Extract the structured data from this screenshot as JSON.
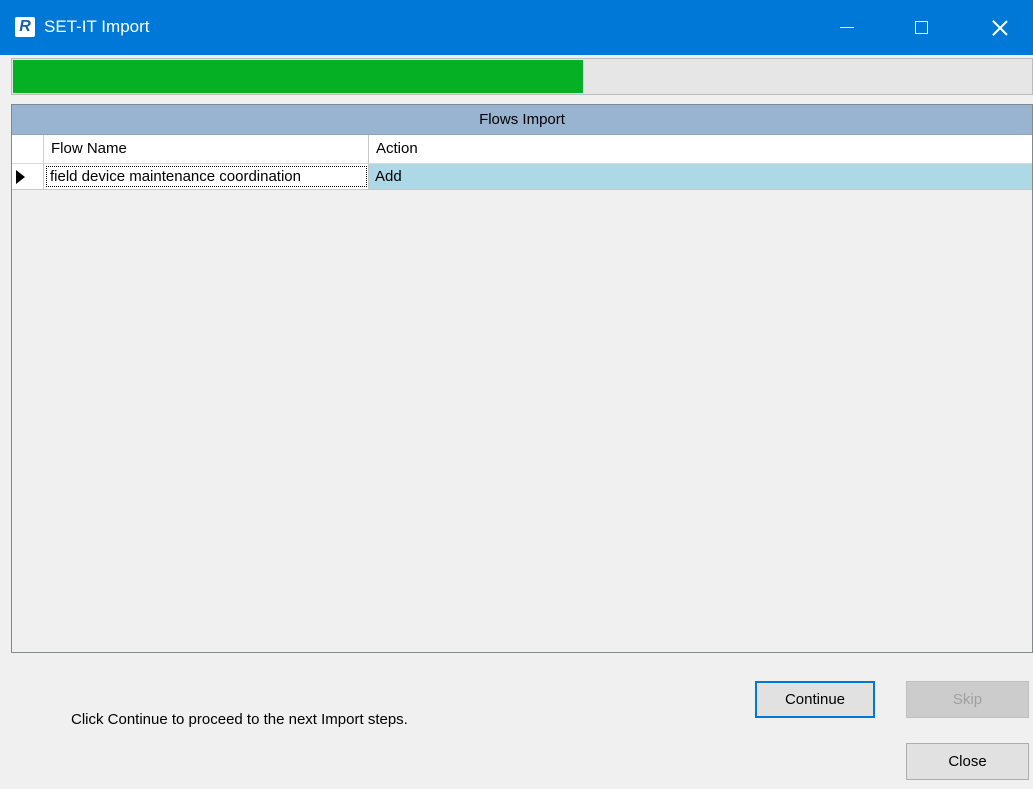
{
  "window": {
    "title": "SET-IT Import",
    "app_icon_letter": "R",
    "titlebar_color": "#0078d7"
  },
  "window_controls": {
    "minimize_icon": "minimize-icon",
    "maximize_icon": "maximize-icon",
    "close_icon": "close-icon"
  },
  "progress": {
    "fraction": 0.56,
    "color": "#06b025"
  },
  "grid": {
    "caption": "Flows Import",
    "caption_color": "#99b4d1",
    "columns": [
      "Flow Name",
      "Action"
    ],
    "rows": [
      {
        "flow_name": "field device maintenance coordination",
        "action": "Add"
      }
    ],
    "selected_row_color": "#add8e6",
    "current_row_icon": "row-pointer-icon"
  },
  "footer": {
    "hint": "Click Continue to proceed to the next Import steps.",
    "continue_label": "Continue",
    "skip_label": "Skip",
    "close_label": "Close"
  }
}
